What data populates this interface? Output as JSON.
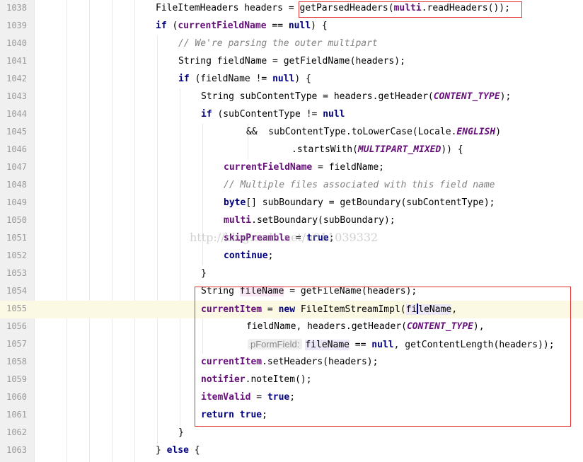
{
  "watermark": "http://blog.csdn.net/u011039332",
  "hint_label": "pFormField:",
  "lines": [
    {
      "num": "1038",
      "tokens": [
        "FileItemHeaders headers = ",
        "getParsedHeaders(",
        "multi",
        ".readHeaders());"
      ]
    },
    {
      "num": "1039",
      "tokens": [
        "if",
        " (",
        "currentFieldName",
        " == ",
        "null",
        ") {"
      ]
    },
    {
      "num": "1040",
      "tokens": [
        "// We're parsing the outer multipart"
      ]
    },
    {
      "num": "1041",
      "tokens": [
        "String fieldName = getFieldName(headers);"
      ]
    },
    {
      "num": "1042",
      "tokens": [
        "if",
        " (fieldName != ",
        "null",
        ") {"
      ]
    },
    {
      "num": "1043",
      "tokens": [
        "String subContentType = headers.getHeader(",
        "CONTENT_TYPE",
        ");"
      ]
    },
    {
      "num": "1044",
      "tokens": [
        "if",
        " (subContentType != ",
        "null"
      ]
    },
    {
      "num": "1045",
      "tokens": [
        "&&  subContentType.toLowerCase(Locale.",
        "ENGLISH",
        ")"
      ]
    },
    {
      "num": "1046",
      "tokens": [
        ".startsWith(",
        "MULTIPART_MIXED",
        ")) {"
      ]
    },
    {
      "num": "1047",
      "tokens": [
        "currentFieldName",
        " = fieldName;"
      ]
    },
    {
      "num": "1048",
      "tokens": [
        "// Multiple files associated with this field name"
      ]
    },
    {
      "num": "1049",
      "tokens": [
        "byte",
        "[] subBoundary = getBoundary(subContentType);"
      ]
    },
    {
      "num": "1050",
      "tokens": [
        "multi",
        ".setBoundary(subBoundary);"
      ]
    },
    {
      "num": "1051",
      "tokens": [
        "skipPreamble",
        " = ",
        "true",
        ";"
      ]
    },
    {
      "num": "1052",
      "tokens": [
        "continue",
        ";"
      ]
    },
    {
      "num": "1053",
      "tokens": [
        "}"
      ]
    },
    {
      "num": "1054",
      "tokens": [
        "String ",
        "fileName",
        " = getFileName(headers);"
      ]
    },
    {
      "num": "1055",
      "tokens": [
        "currentItem",
        " = ",
        "new",
        " FileItemStreamImpl(",
        "fi",
        "leName",
        ","
      ]
    },
    {
      "num": "1056",
      "tokens": [
        "fieldName, headers.getHeader(",
        "CONTENT_TYPE",
        "),"
      ]
    },
    {
      "num": "1057",
      "tokens": [
        "fileName",
        " == ",
        "null",
        ", getContentLength(headers));"
      ]
    },
    {
      "num": "1058",
      "tokens": [
        "currentItem",
        ".setHeaders(headers);"
      ]
    },
    {
      "num": "1059",
      "tokens": [
        "notifier",
        ".noteItem();"
      ]
    },
    {
      "num": "1060",
      "tokens": [
        "itemValid",
        " = ",
        "true",
        ";"
      ]
    },
    {
      "num": "1061",
      "tokens": [
        "return",
        " ",
        "true",
        ";"
      ]
    },
    {
      "num": "1062",
      "tokens": [
        "}"
      ]
    },
    {
      "num": "1063",
      "tokens": [
        "}",
        " ",
        "else",
        " {"
      ]
    }
  ]
}
